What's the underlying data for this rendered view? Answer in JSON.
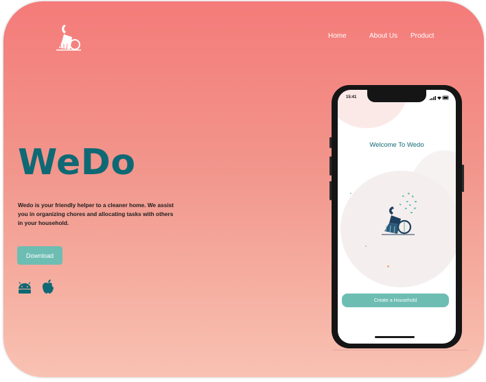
{
  "nav": {
    "items": [
      "Home",
      "About Us",
      "Product"
    ]
  },
  "hero": {
    "title": "WeDo",
    "description": "Wedo is your friendly helper to a cleaner home. We assist you in organizing chores and allocating tasks with others in your household.",
    "download_label": "Download",
    "platform_icons": [
      "android-icon",
      "apple-icon"
    ]
  },
  "phone": {
    "status_time": "15:41",
    "welcome_text": "Welcome To Wedo",
    "create_household_label": "Create a Household"
  },
  "colors": {
    "accent_teal": "#0f6974",
    "button_teal": "#6dbdb3",
    "background_top": "#f47b79",
    "background_bottom": "#f8c2b2"
  }
}
